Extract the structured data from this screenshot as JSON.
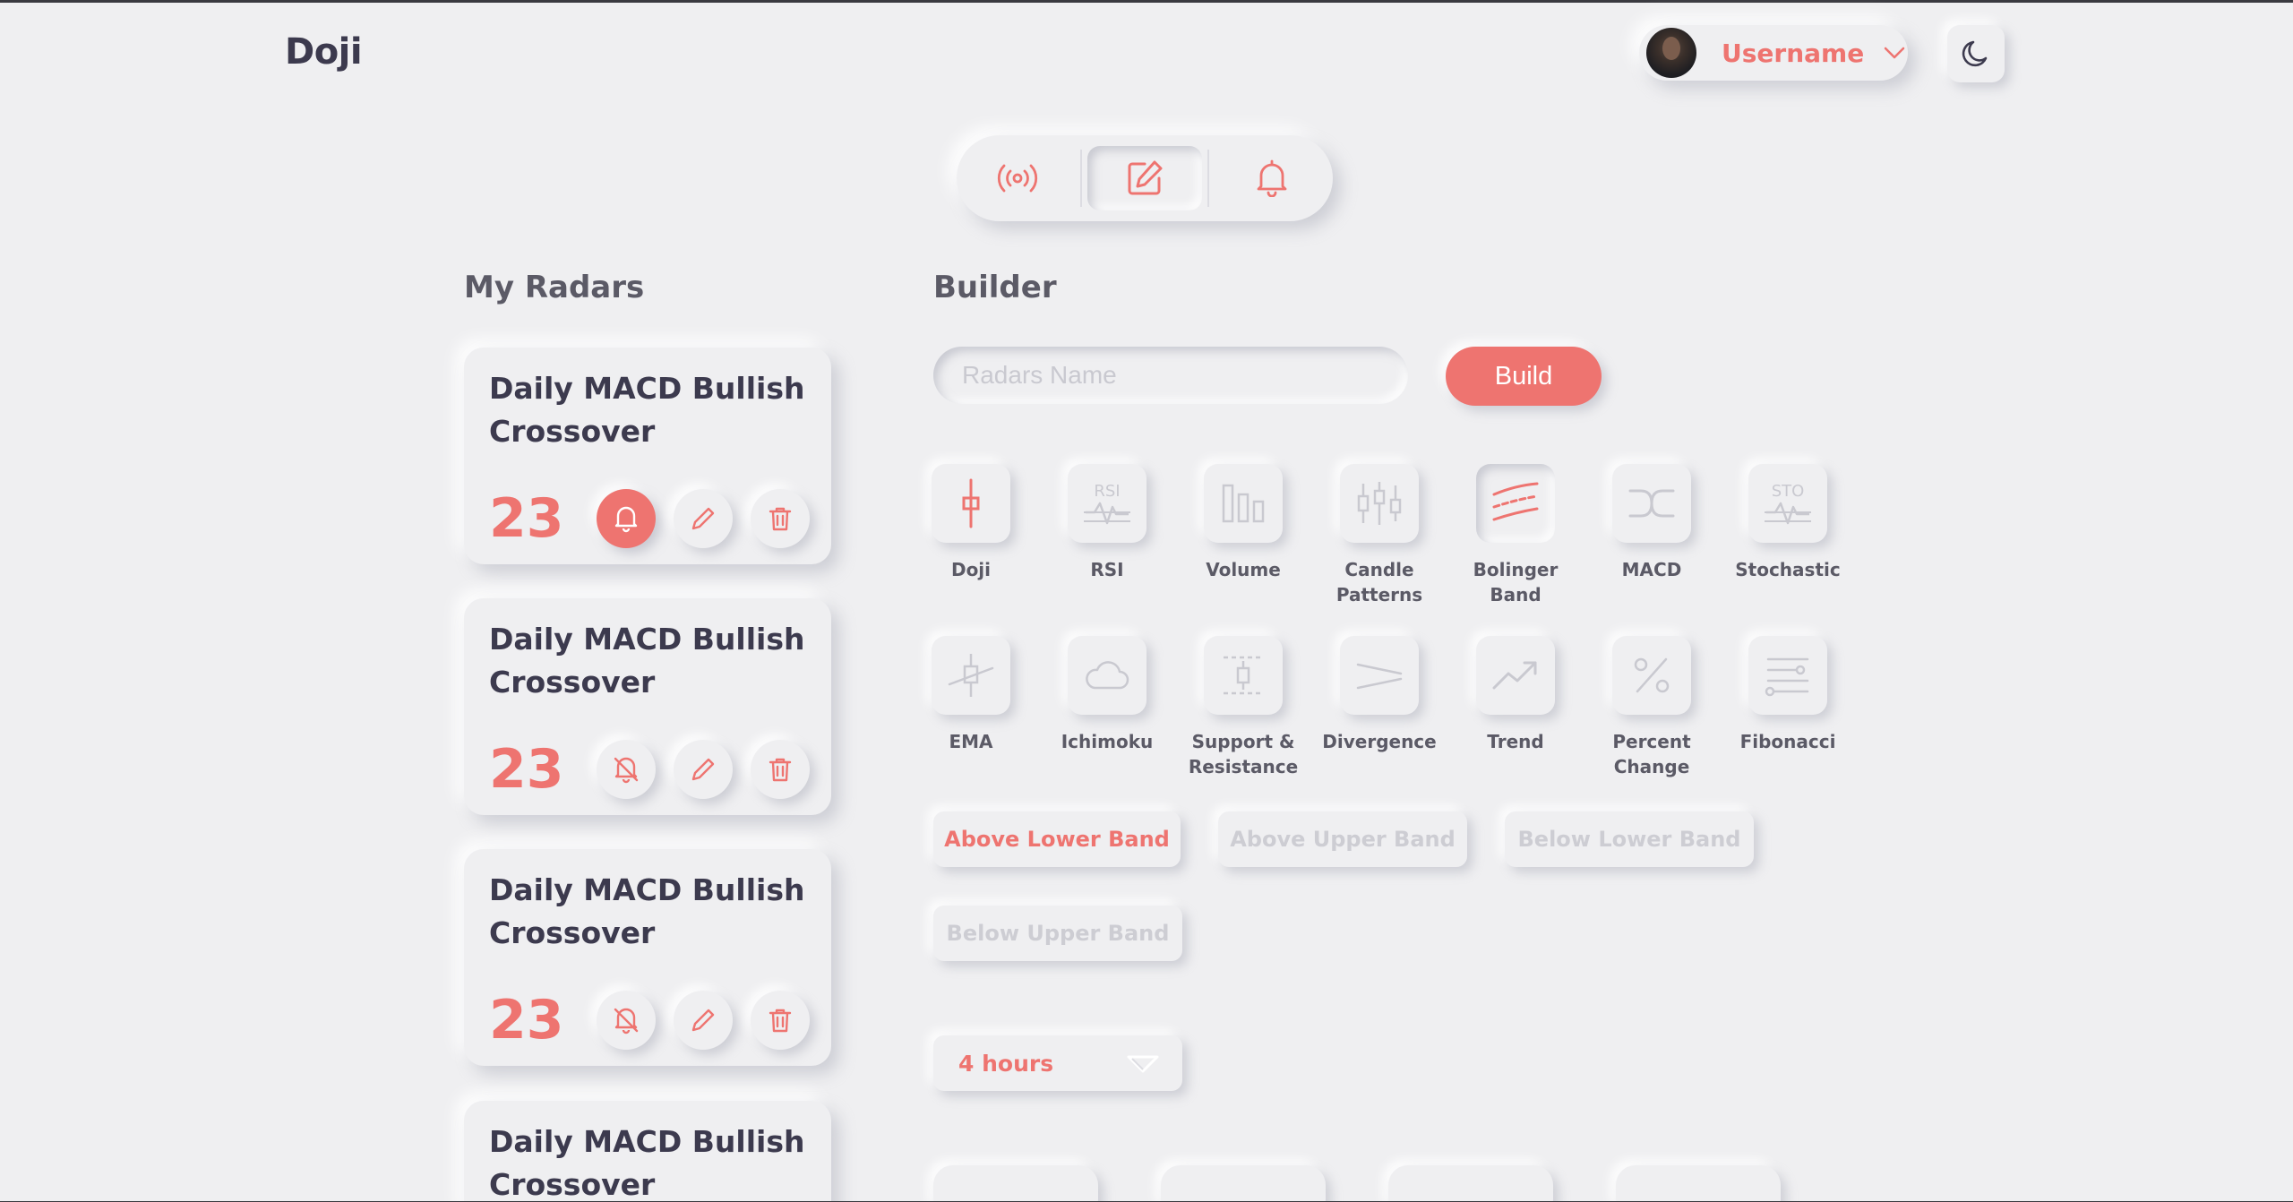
{
  "app": {
    "logo": "Doji"
  },
  "header": {
    "username": "Username"
  },
  "tabs": [
    "radar-tab",
    "builder-tab",
    "alerts-tab"
  ],
  "my_radars": {
    "title": "My Radars",
    "items": [
      {
        "title": "Daily MACD Bullish Crossover",
        "count": "23",
        "alert_active": true
      },
      {
        "title": "Daily MACD Bullish Crossover",
        "count": "23",
        "alert_active": false
      },
      {
        "title": "Daily MACD Bullish Crossover",
        "count": "23",
        "alert_active": false
      },
      {
        "title": "Daily MACD Bullish Crossover",
        "count": ""
      }
    ]
  },
  "builder": {
    "title": "Builder",
    "name_placeholder": "Radars Name",
    "build_label": "Build",
    "indicators": [
      {
        "label": "Doji",
        "icon": "doji-candle-icon"
      },
      {
        "label": "RSI",
        "icon": "rsi-icon",
        "icon_text": "RSI"
      },
      {
        "label": "Volume",
        "icon": "volume-bars-icon"
      },
      {
        "label": "Candle Patterns",
        "icon": "candle-patterns-icon"
      },
      {
        "label": "Bolinger Band",
        "icon": "bollinger-band-icon",
        "selected": true
      },
      {
        "label": "MACD",
        "icon": "macd-cross-icon"
      },
      {
        "label": "Stochastic",
        "icon": "stochastic-icon",
        "icon_text": "STO"
      },
      {
        "label": "EMA",
        "icon": "ema-icon"
      },
      {
        "label": "Ichimoku",
        "icon": "cloud-icon"
      },
      {
        "label": "Support & Resistance",
        "icon": "support-resistance-icon"
      },
      {
        "label": "Divergence",
        "icon": "divergence-icon"
      },
      {
        "label": "Trend",
        "icon": "trend-icon"
      },
      {
        "label": "Percent Change",
        "icon": "percent-icon"
      },
      {
        "label": "Fibonacci",
        "icon": "fibonacci-icon"
      }
    ],
    "band_options": [
      "Above Lower Band",
      "Above Upper Band",
      "Below Lower Band",
      "Below Upper Band"
    ],
    "selected_band": "Above Lower Band",
    "timeframe": "4 hours"
  },
  "colors": {
    "accent": "#ee7470",
    "background": "#efeff1",
    "text": "#3c3a4e",
    "muted": "#cdcdd3"
  }
}
